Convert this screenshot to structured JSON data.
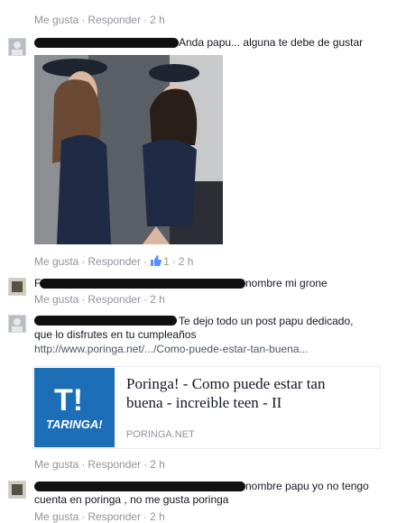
{
  "actions": {
    "like": "Me gusta",
    "reply": "Responder",
    "sep": "·"
  },
  "comments": [
    {
      "time": "2 h"
    },
    {
      "text": "Anda papu... alguna te debe de gustar",
      "time": "2 h",
      "likes": "1"
    },
    {
      "prefix": "F",
      "text": "nombre mi grone",
      "time": "2 h"
    },
    {
      "text_line1": "Te dejo todo un post papu dedicado,",
      "text_line2": "que lo disfrutes en tu cumpleaños",
      "url": "http://www.poringa.net/.../Como-puede-estar-tan-buena...",
      "time": "2 h",
      "card": {
        "logo_big": "T!",
        "logo_small": "TARINGA!",
        "title_line1": "Poringa! - Como puede estar tan",
        "title_line2": "buena - increible teen - II",
        "domain": "PORINGA.NET"
      }
    },
    {
      "text_line1": "nombre papu yo no tengo",
      "text_line2": "cuenta en poringa , no me gusta poringa",
      "time": "2 h"
    }
  ],
  "icons": {
    "like": "thumbs-up-icon"
  },
  "colors": {
    "meta": "#90949c",
    "brand": "#1c6fb6",
    "text": "#141823"
  }
}
